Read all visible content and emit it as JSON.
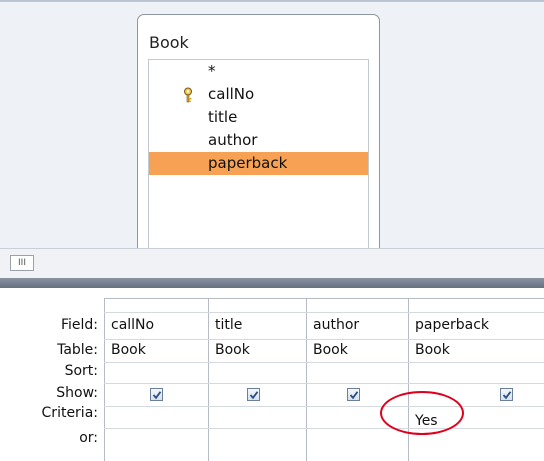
{
  "table": {
    "title": "Book",
    "fields": [
      "*",
      "callNo",
      "title",
      "author",
      "paperback"
    ],
    "primary_key_field": "callNo",
    "selected_field": "paperback",
    "selected_color": "#f7a154"
  },
  "splitter": {
    "grip_label": "III"
  },
  "grid": {
    "row_labels": {
      "field": "Field:",
      "table": "Table:",
      "sort": "Sort:",
      "show": "Show:",
      "criteria": "Criteria:",
      "or": "or:"
    },
    "columns": [
      {
        "field": "callNo",
        "table": "Book",
        "sort": "",
        "show": true,
        "criteria": ""
      },
      {
        "field": "title",
        "table": "Book",
        "sort": "",
        "show": true,
        "criteria": ""
      },
      {
        "field": "author",
        "table": "Book",
        "sort": "",
        "show": true,
        "criteria": ""
      },
      {
        "field": "paperback",
        "table": "Book",
        "sort": "",
        "show": true,
        "criteria": "Yes"
      }
    ],
    "annotation_color": "#e0001b"
  }
}
